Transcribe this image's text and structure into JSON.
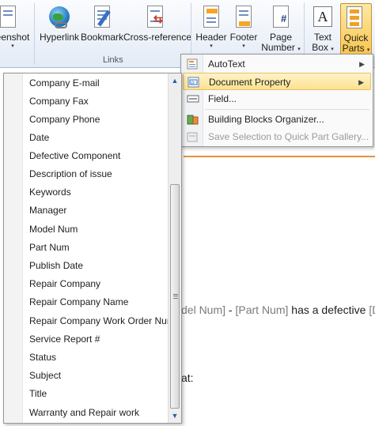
{
  "ribbon": {
    "buttons": [
      {
        "label": "eenshot",
        "icon": "screenshot-icon"
      },
      {
        "label": "Hyperlink",
        "icon": "hyperlink-icon"
      },
      {
        "label": "Bookmark",
        "icon": "bookmark-icon"
      },
      {
        "label": "Cross-reference",
        "icon": "cross-reference-icon"
      },
      {
        "label": "Header",
        "icon": "header-icon"
      },
      {
        "label": "Footer",
        "icon": "footer-icon"
      },
      {
        "label_line1": "Page",
        "label_line2": "Number",
        "icon": "page-number-icon"
      },
      {
        "label_line1": "Text",
        "label_line2": "Box",
        "icon": "text-box-icon"
      },
      {
        "label_line1": "Quick",
        "label_line2": "Parts",
        "icon": "quick-parts-icon"
      }
    ],
    "group_links": "Links"
  },
  "quick_parts_menu": {
    "items": [
      {
        "label": "AutoText",
        "icon": "autotext-icon"
      },
      {
        "label": "Document Property",
        "icon": "document-property-icon"
      },
      {
        "label": "Field...",
        "icon": "field-icon"
      },
      {
        "label": "Building Blocks Organizer...",
        "icon": "building-blocks-icon"
      },
      {
        "label": "Save Selection to Quick Part Gallery...",
        "icon": "save-selection-icon"
      }
    ]
  },
  "document_property_list": {
    "items": [
      "Company E-mail",
      "Company Fax",
      "Company Phone",
      "Date",
      "Defective Component",
      "Description of issue",
      "Keywords",
      "Manager",
      "Model Num",
      "Part Num",
      "Publish Date",
      "Repair Company",
      "Repair Company Name",
      "Repair Company Work Order Num",
      "Service Report #",
      "Status",
      "Subject",
      "Title",
      "Warranty and Repair work"
    ]
  },
  "document": {
    "line1_field_a": "del Num]",
    "line1_sep": " - ",
    "line1_field_b": "[Part Num]",
    "line1_text": " has a defective ",
    "line1_field_c": "[D",
    "line2_text": "at:"
  },
  "colors": {
    "accent_orange": "#e7913c",
    "highlight": "#fde18f",
    "field_gray": "#7a7a7a"
  }
}
